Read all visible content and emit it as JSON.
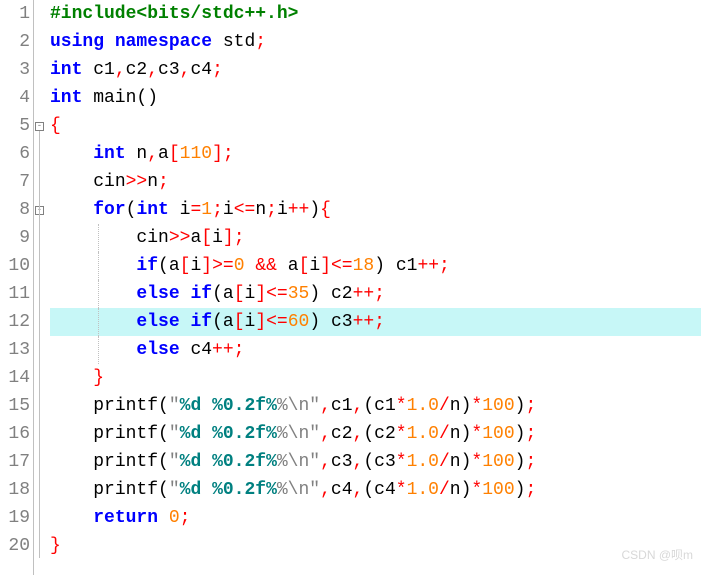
{
  "lines": {
    "count": 20,
    "highlight": 12,
    "fold_boxes": [
      5,
      8
    ],
    "fold_line_start": 5,
    "fold_line_end": 20
  },
  "code": {
    "l1_include": "#include",
    "l1_header": "<bits/stdc++.h>",
    "l2_using": "using",
    "l2_namespace": "namespace",
    "l2_std": " std",
    "l2_semi": ";",
    "l3_int": "int",
    "l3_vars": " c1",
    "l3_c2": "c2",
    "l3_c3": "c3",
    "l3_c4": "c4",
    "l3_comma": ",",
    "l3_semi": ";",
    "l4_int": "int",
    "l4_main": " main",
    "l4_parens": "()",
    "l5_brace": "{",
    "l6_int": "int",
    "l6_n": " n",
    "l6_a": "a",
    "l6_110": "110",
    "l6_lbrack": "[",
    "l6_rbrack": "]",
    "l6_comma": ",",
    "l6_semi": ";",
    "l7_cin": "cin",
    "l7_shr": ">>",
    "l7_n": "n",
    "l7_semi": ";",
    "l8_for": "for",
    "l8_int": "int",
    "l8_i": " i",
    "l8_eq": "=",
    "l8_1": "1",
    "l8_semi1": ";",
    "l8_i2": "i",
    "l8_le": "<=",
    "l8_n": "n",
    "l8_semi2": ";",
    "l8_i3": "i",
    "l8_pp": "++",
    "l8_lbrace": "{",
    "l9_cin": "cin",
    "l9_shr": ">>",
    "l9_a": "a",
    "l9_lbrack": "[",
    "l9_i": "i",
    "l9_rbrack": "]",
    "l9_semi": ";",
    "l10_if": "if",
    "l10_a": "a",
    "l10_lbrack": "[",
    "l10_i": "i",
    "l10_rbrack": "]",
    "l10_ge": ">=",
    "l10_0": "0",
    "l10_and": "&&",
    "l10_a2": "a",
    "l10_i2": "i",
    "l10_le": "<=",
    "l10_18": "18",
    "l10_c1": " c1",
    "l10_pp": "++",
    "l10_semi": ";",
    "l11_else": "else",
    "l11_if": "if",
    "l11_a": "a",
    "l11_i": "i",
    "l11_le": "<=",
    "l11_35": "35",
    "l11_c2": " c2",
    "l11_pp": "++",
    "l11_semi": ";",
    "l12_else": "else",
    "l12_if": "if",
    "l12_a": "a",
    "l12_i": "i",
    "l12_le": "<=",
    "l12_60": "60",
    "l12_c3": " c3",
    "l12_pp": "++",
    "l12_semi": ";",
    "l13_else": "else",
    "l13_c4": " c4",
    "l13_pp": "++",
    "l13_semi": ";",
    "l14_rbrace": "}",
    "printf": "printf",
    "str_q": "\"",
    "str_1": "%d ",
    "str_2": "%0.2f%",
    "str_3": "%\\n",
    "p_comma": ",",
    "p_star": "*",
    "p_10": "1.0",
    "p_slash": "/",
    "p_n": "n",
    "p_100": "100",
    "p_semi": ";",
    "l15_c": "c1",
    "l16_c": "c2",
    "l17_c": "c3",
    "l18_c": "c4",
    "l19_return": "return",
    "l19_0": "0",
    "l19_semi": ";",
    "l20_rbrace": "}"
  },
  "watermark": "CSDN @呗m"
}
